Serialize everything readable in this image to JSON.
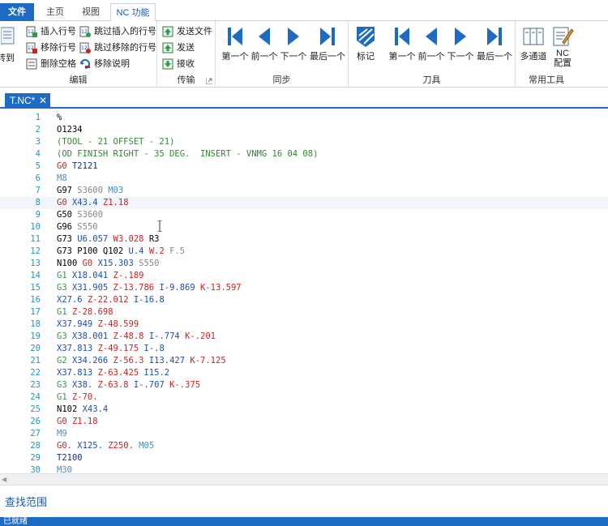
{
  "tabs": {
    "file": "文件",
    "home": "主页",
    "view": "视图",
    "nc": "NC 功能"
  },
  "ribbon": {
    "edit_group": {
      "label": "编辑",
      "goto": "转到",
      "insert_line_no": "插入行号",
      "remove_line_no": "移除行号",
      "remove_spaces": "删除空格",
      "skip_insert_line_no": "跳过插入的行号",
      "skip_remove_line_no": "跳过移除的行号",
      "remove_comments": "移除说明"
    },
    "transfer_group": {
      "label": "传输",
      "send_file": "发送文件",
      "send": "发送",
      "receive": "接收"
    },
    "sync_group": {
      "label": "同步",
      "first": "第一个",
      "prev": "前一个",
      "next": "下一个",
      "last": "最后一个"
    },
    "tool_group": {
      "label": "刀具",
      "mark": "标记",
      "first": "第一个",
      "prev": "前一个",
      "next": "下一个",
      "last": "最后一个"
    },
    "common_group": {
      "label": "常用工具",
      "multichannel": "多通道",
      "nc_config": "NC\n配置"
    }
  },
  "document": {
    "tab_title": "T.NC*",
    "current_line": 8
  },
  "code_lines": [
    [
      [
        "pct",
        "%"
      ]
    ],
    [
      [
        "o",
        "O1234"
      ]
    ],
    [
      [
        "c",
        "(TOOL - 21 OFFSET - 21)"
      ]
    ],
    [
      [
        "c",
        "(OD FINISH RIGHT - 35 DEG.  INSERT - VNMG 16 04 08)"
      ]
    ],
    [
      [
        "g0",
        "G0 "
      ],
      [
        "t",
        "T2121"
      ]
    ],
    [
      [
        "m",
        "M8"
      ]
    ],
    [
      [
        "g",
        "G97 "
      ],
      [
        "s",
        "S3600 "
      ],
      [
        "m",
        "M03"
      ]
    ],
    [
      [
        "g0",
        "G0 "
      ],
      [
        "x",
        "X43.4 "
      ],
      [
        "z",
        "Z1.18"
      ]
    ],
    [
      [
        "g",
        "G50 "
      ],
      [
        "s",
        "S3600"
      ]
    ],
    [
      [
        "g",
        "G96 "
      ],
      [
        "s",
        "S550"
      ]
    ],
    [
      [
        "g",
        "G73 "
      ],
      [
        "u",
        "U6.057 "
      ],
      [
        "w",
        "W3.028 "
      ],
      [
        "r",
        "R3"
      ]
    ],
    [
      [
        "g",
        "G73 "
      ],
      [
        "p",
        "P100 Q102 "
      ],
      [
        "u",
        "U.4 "
      ],
      [
        "w",
        "W.2 "
      ],
      [
        "f",
        "F.5"
      ]
    ],
    [
      [
        "n",
        "N100 "
      ],
      [
        "g0",
        "G0 "
      ],
      [
        "x",
        "X15.303 "
      ],
      [
        "s",
        "S550"
      ]
    ],
    [
      [
        "g1",
        "G1 "
      ],
      [
        "x",
        "X18.041 "
      ],
      [
        "z",
        "Z-.189"
      ]
    ],
    [
      [
        "g3",
        "G3 "
      ],
      [
        "x",
        "X31.905 "
      ],
      [
        "z",
        "Z-13.786 "
      ],
      [
        "i",
        "I-9.869 "
      ],
      [
        "k",
        "K-13.597"
      ]
    ],
    [
      [
        "x",
        "X27.6 "
      ],
      [
        "z",
        "Z-22.012 "
      ],
      [
        "i",
        "I-16.8"
      ]
    ],
    [
      [
        "g1",
        "G1 "
      ],
      [
        "z",
        "Z-28.698"
      ]
    ],
    [
      [
        "x",
        "X37.949 "
      ],
      [
        "z",
        "Z-48.599"
      ]
    ],
    [
      [
        "g3",
        "G3 "
      ],
      [
        "x",
        "X38.001 "
      ],
      [
        "z",
        "Z-48.8 "
      ],
      [
        "i",
        "I-.774 "
      ],
      [
        "k",
        "K-.201"
      ]
    ],
    [
      [
        "x",
        "X37.813 "
      ],
      [
        "z",
        "Z-49.175 "
      ],
      [
        "i",
        "I-.8"
      ]
    ],
    [
      [
        "g2",
        "G2 "
      ],
      [
        "x",
        "X34.266 "
      ],
      [
        "z",
        "Z-56.3 "
      ],
      [
        "i",
        "I13.427 "
      ],
      [
        "k",
        "K-7.125"
      ]
    ],
    [
      [
        "x",
        "X37.813 "
      ],
      [
        "z",
        "Z-63.425 "
      ],
      [
        "i",
        "I15.2"
      ]
    ],
    [
      [
        "g3",
        "G3 "
      ],
      [
        "x",
        "X38. "
      ],
      [
        "z",
        "Z-63.8 "
      ],
      [
        "i",
        "I-.707 "
      ],
      [
        "k",
        "K-.375"
      ]
    ],
    [
      [
        "g1",
        "G1 "
      ],
      [
        "z",
        "Z-70."
      ]
    ],
    [
      [
        "n",
        "N102 "
      ],
      [
        "x",
        "X43.4"
      ]
    ],
    [
      [
        "g0",
        "G0 "
      ],
      [
        "z",
        "Z1.18"
      ]
    ],
    [
      [
        "m",
        "M9"
      ]
    ],
    [
      [
        "g0",
        "G0. "
      ],
      [
        "x",
        "X125. "
      ],
      [
        "z",
        "Z250. "
      ],
      [
        "m",
        "M05"
      ]
    ],
    [
      [
        "t",
        "T2100"
      ]
    ],
    [
      [
        "m",
        "M30"
      ]
    ]
  ],
  "find_panel": {
    "title": "查找范围"
  },
  "status": {
    "text": "已就绪"
  }
}
